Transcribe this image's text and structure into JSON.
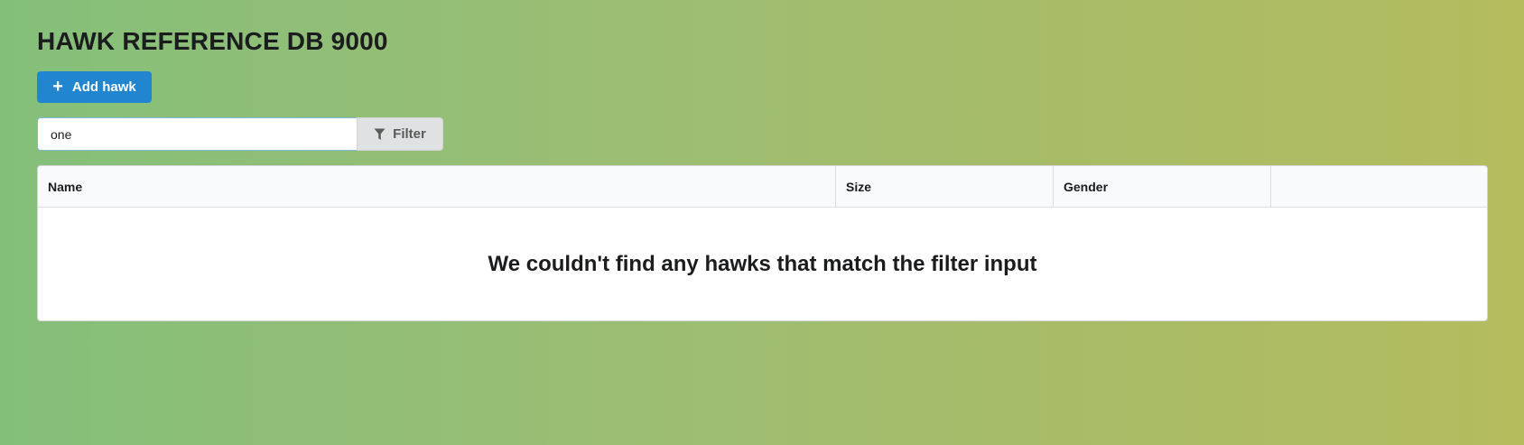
{
  "header": {
    "title": "HAWK REFERENCE DB 9000"
  },
  "toolbar": {
    "add_label": "Add hawk",
    "add_icon": "plus-icon"
  },
  "filter": {
    "value": "one",
    "button_label": "Filter",
    "button_icon": "filter-icon"
  },
  "table": {
    "columns": [
      "Name",
      "Size",
      "Gender",
      ""
    ],
    "empty_message": "We couldn't find any hawks that match the filter input"
  },
  "colors": {
    "primary": "#2185d0",
    "background_gradient_start": "#84bf7a",
    "background_gradient_end": "#b4bc5e"
  }
}
